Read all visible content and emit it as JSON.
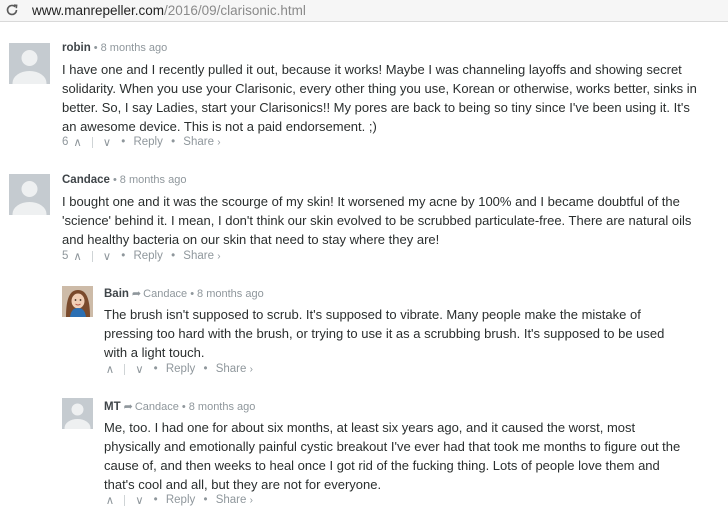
{
  "browser": {
    "url_host": "www.manrepeller.com",
    "url_path": "/2016/09/clarisonic.html"
  },
  "comments": [
    {
      "author": "robin",
      "time": "8 months ago",
      "lines": [
        "I have one and I recently pulled it out, because it works! Maybe I was channeling layoffs and showing secret",
        "solidarity. When you use your Clarisonic, every other thing you use, Korean or otherwise, works better, sinks in",
        "better. So, I say Ladies, start your Clarisonics!! My pores are back to being so tiny since I've been using it. It's",
        "an awesome device. This is not a paid endorsement. ;)"
      ],
      "votes": "6",
      "reply": "Reply",
      "share": "Share"
    },
    {
      "author": "Candace",
      "time": "8 months ago",
      "lines": [
        "I bought one and it was the scourge of my skin! It worsened my acne by 100% and I became doubtful of the",
        "'science' behind it. I mean, I don't think our skin evolved to be scrubbed particulate-free. There are natural oils",
        "and healthy bacteria on our skin that need to stay where they are!"
      ],
      "votes": "5",
      "reply": "Reply",
      "share": "Share"
    },
    {
      "author": "Bain",
      "parent": "Candace",
      "time": "8 months ago",
      "lines": [
        "The brush isn't supposed to scrub. It's supposed to vibrate. Many people make the mistake of",
        "pressing too hard with the brush, or trying to use it as a scrubbing brush. It's supposed to be used",
        "with a light touch."
      ],
      "votes": "",
      "reply": "Reply",
      "share": "Share"
    },
    {
      "author": "MT",
      "parent": "Candace",
      "time": "8 months ago",
      "lines": [
        "Me, too. I had one for about six months, at least six years ago, and it caused the worst, most",
        "physically and emotionally painful cystic breakout I've ever had that took me months to figure out the",
        "cause of, and then weeks to heal once I got rid of the fucking thing. Lots of people love them and",
        "that's cool and all, but they are not for everyone."
      ],
      "votes": "",
      "reply": "Reply",
      "share": "Share"
    }
  ],
  "symbols": {
    "dot": "•",
    "reply_arrow": "➦",
    "share_chevron": "›",
    "up": "∧",
    "down": "∨"
  }
}
